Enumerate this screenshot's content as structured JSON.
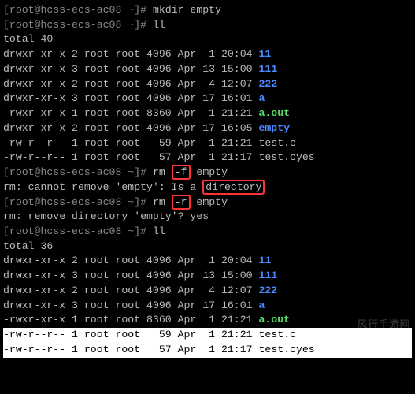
{
  "prompt_prefix": "[root@hcss-ecs-ac08 ~]# ",
  "cmd_mkdir": "mkdir empty",
  "cmd_ll1": "ll",
  "total1": "total 40",
  "ls1": [
    {
      "perm": "drwxr-xr-x",
      "links": "2",
      "o": "root",
      "g": "root",
      "size": "4096",
      "date": "Apr  1 20:04",
      "name": "11",
      "cls": "blue"
    },
    {
      "perm": "drwxr-xr-x",
      "links": "3",
      "o": "root",
      "g": "root",
      "size": "4096",
      "date": "Apr 13 15:00",
      "name": "111",
      "cls": "blue"
    },
    {
      "perm": "drwxr-xr-x",
      "links": "2",
      "o": "root",
      "g": "root",
      "size": "4096",
      "date": "Apr  4 12:07",
      "name": "222",
      "cls": "blue"
    },
    {
      "perm": "drwxr-xr-x",
      "links": "3",
      "o": "root",
      "g": "root",
      "size": "4096",
      "date": "Apr 17 16:01",
      "name": "a",
      "cls": "blue"
    },
    {
      "perm": "-rwxr-xr-x",
      "links": "1",
      "o": "root",
      "g": "root",
      "size": "8360",
      "date": "Apr  1 21:21",
      "name": "a.out",
      "cls": "green"
    },
    {
      "perm": "drwxr-xr-x",
      "links": "2",
      "o": "root",
      "g": "root",
      "size": "4096",
      "date": "Apr 17 16:05",
      "name": "empty",
      "cls": "blue"
    },
    {
      "perm": "-rw-r--r--",
      "links": "1",
      "o": "root",
      "g": "root",
      "size": "  59",
      "date": "Apr  1 21:21",
      "name": "test.c",
      "cls": "txt"
    },
    {
      "perm": "-rw-r--r--",
      "links": "1",
      "o": "root",
      "g": "root",
      "size": "  57",
      "date": "Apr  1 21:17",
      "name": "test.cyes",
      "cls": "txt"
    }
  ],
  "rmf_pre": "rm ",
  "rmf_flag": "-f",
  "rmf_post": " empty",
  "rm_err_pre": "rm: cannot remove 'empty': Is a ",
  "rm_err_word": "directory",
  "rmr_pre": "rm ",
  "rmr_flag": "-r",
  "rmr_post": " empty",
  "rm_prompt": "rm: remove directory 'empty'? yes",
  "cmd_ll2": "ll",
  "total2": "total 36",
  "ls2": [
    {
      "perm": "drwxr-xr-x",
      "links": "2",
      "o": "root",
      "g": "root",
      "size": "4096",
      "date": "Apr  1 20:04",
      "name": "11",
      "cls": "blue",
      "hl": false
    },
    {
      "perm": "drwxr-xr-x",
      "links": "3",
      "o": "root",
      "g": "root",
      "size": "4096",
      "date": "Apr 13 15:00",
      "name": "111",
      "cls": "blue",
      "hl": false
    },
    {
      "perm": "drwxr-xr-x",
      "links": "2",
      "o": "root",
      "g": "root",
      "size": "4096",
      "date": "Apr  4 12:07",
      "name": "222",
      "cls": "blue",
      "hl": false
    },
    {
      "perm": "drwxr-xr-x",
      "links": "3",
      "o": "root",
      "g": "root",
      "size": "4096",
      "date": "Apr 17 16:01",
      "name": "a",
      "cls": "blue",
      "hl": false
    },
    {
      "perm": "-rwxr-xr-x",
      "links": "1",
      "o": "root",
      "g": "root",
      "size": "8360",
      "date": "Apr  1 21:21",
      "name": "a.out",
      "cls": "green",
      "hl": false
    },
    {
      "perm": "-rw-r--r--",
      "links": "1",
      "o": "root",
      "g": "root",
      "size": "  59",
      "date": "Apr  1 21:21",
      "name": "test.c",
      "cls": "txt",
      "hl": true
    },
    {
      "perm": "-rw-r--r--",
      "links": "1",
      "o": "root",
      "g": "root",
      "size": "  57",
      "date": "Apr  1 21:17",
      "name": "test.cyes",
      "cls": "txt",
      "hl": true
    }
  ],
  "watermark": "风行手游网"
}
